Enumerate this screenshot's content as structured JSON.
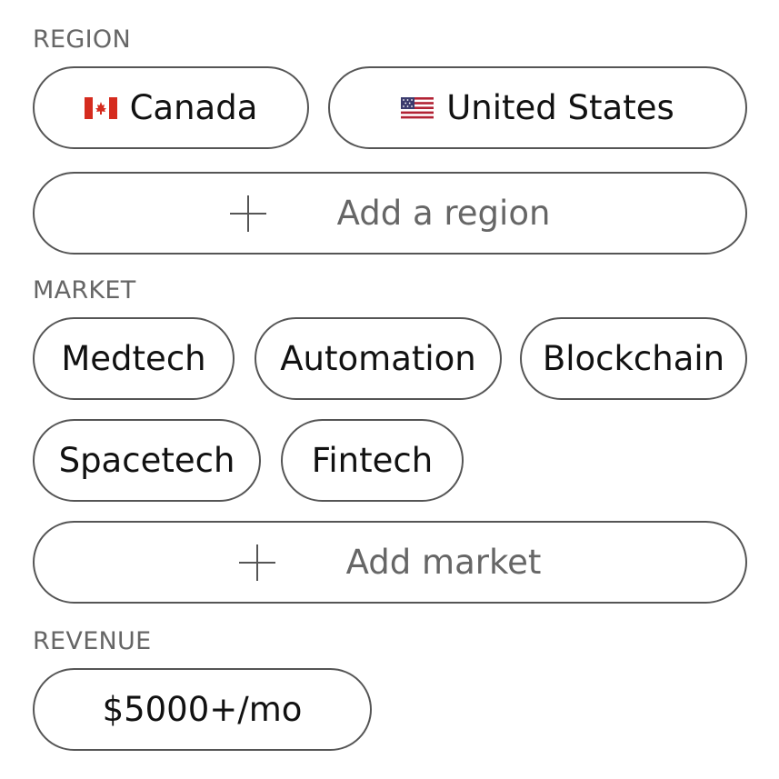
{
  "region": {
    "label": "REGION",
    "chips": [
      {
        "label": "Canada",
        "icon": "canada-flag-icon"
      },
      {
        "label": "United States",
        "icon": "us-flag-icon"
      }
    ],
    "add_label": "Add a region"
  },
  "market": {
    "label": "MARKET",
    "chips": [
      {
        "label": "Medtech"
      },
      {
        "label": "Automation"
      },
      {
        "label": "Blockchain"
      },
      {
        "label": "Spacetech"
      },
      {
        "label": "Fintech"
      }
    ],
    "add_label": "Add market"
  },
  "revenue": {
    "label": "REVENUE",
    "chips": [
      {
        "label": "$5000+/mo"
      }
    ]
  },
  "colors": {
    "border": "#555555",
    "label_gray": "#666666",
    "text": "#111111",
    "canada_red": "#d52b1e",
    "us_blue": "#3c3b6e",
    "us_red": "#b22234"
  }
}
